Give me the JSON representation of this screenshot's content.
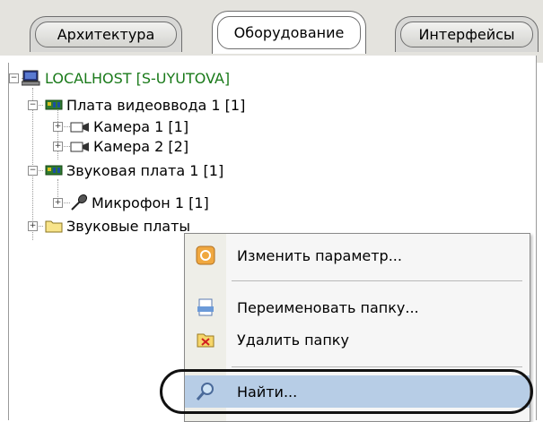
{
  "tabs": [
    {
      "label": "Архитектура",
      "active": false
    },
    {
      "label": "Оборудование",
      "active": true
    },
    {
      "label": "Интерфейсы",
      "active": false
    }
  ],
  "tree": {
    "root": {
      "label": "LOCALHOST [S-UYUTOVA]",
      "icon": "computer-icon",
      "color": "#1a7a1a"
    },
    "video_board": {
      "label": "Плата видеоввода 1 [1]",
      "icon": "board-icon"
    },
    "camera1": {
      "label": "Камера 1 [1]",
      "icon": "camera-icon"
    },
    "camera2": {
      "label": "Камера 2 [2]",
      "icon": "camera-icon"
    },
    "sound_board": {
      "label": "Звуковая плата 1 [1]",
      "icon": "board-icon"
    },
    "microphone": {
      "label": "Микрофон 1 [1]",
      "icon": "microphone-icon"
    },
    "sound_folder": {
      "label": "Звуковые платы",
      "icon": "folder-icon"
    }
  },
  "context_menu": {
    "items": [
      {
        "label": "Изменить параметр...",
        "icon": "edit-parameter-icon"
      },
      {
        "label": "Переименовать папку...",
        "icon": "rename-folder-icon"
      },
      {
        "label": "Удалить папку",
        "icon": "delete-folder-icon"
      },
      {
        "label": "Найти...",
        "icon": "search-icon",
        "highlighted": true
      }
    ],
    "highlight_color": "#b7cde6"
  }
}
